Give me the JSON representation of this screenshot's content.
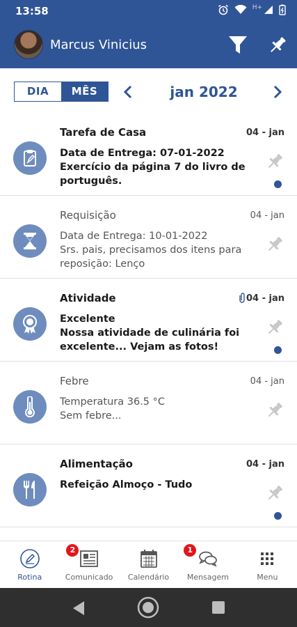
{
  "status_bar": {
    "time": "13:58",
    "network_label": "H+"
  },
  "header": {
    "user_name": "Marcus Vinicius"
  },
  "view_toggle": {
    "day_label": "DIA",
    "month_label": "MÊS",
    "selected": "MÊS"
  },
  "month_nav": {
    "current": "jan 2022"
  },
  "items": [
    {
      "title": "Tarefa de Casa",
      "date": "04 - jan",
      "line1": "Data de Entrega: 07-01-2022",
      "line2": "Exercício da página 7 do livro de português.",
      "unread": true,
      "attachment": false,
      "icon": "clipboard-icon"
    },
    {
      "title": "Requisição",
      "date": "04 - jan",
      "line1": "Data de Entrega: 10-01-2022",
      "line2": "Srs. pais, precisamos dos itens para reposição: Lenço",
      "unread": false,
      "attachment": false,
      "icon": "hourglass-icon"
    },
    {
      "title": "Atividade",
      "date": "04 - jan",
      "line1": "Excelente",
      "line2": "Nossa atividade de culinária foi excelente... Vejam as fotos!",
      "unread": true,
      "attachment": true,
      "icon": "award-icon"
    },
    {
      "title": "Febre",
      "date": "04 - jan",
      "line1": "Temperatura 36.5 °C",
      "line2": "Sem febre...",
      "unread": false,
      "attachment": false,
      "icon": "thermometer-icon"
    },
    {
      "title": "Alimentação",
      "date": "04 - jan",
      "line1": "Refeição Almoço - Tudo",
      "line2": "",
      "unread": true,
      "attachment": false,
      "icon": "fork-knife-icon"
    }
  ],
  "tabs": [
    {
      "label": "Rotina",
      "icon": "pencil-circle-icon",
      "active": true,
      "badge": ""
    },
    {
      "label": "Comunicado",
      "icon": "newspaper-icon",
      "active": false,
      "badge": "2"
    },
    {
      "label": "Calendário",
      "icon": "calendar-icon",
      "active": false,
      "badge": ""
    },
    {
      "label": "Mensagem",
      "icon": "chat-icon",
      "active": false,
      "badge": "1"
    },
    {
      "label": "Menu",
      "icon": "grid-icon",
      "active": false,
      "badge": ""
    }
  ],
  "colors": {
    "primary": "#2f5596",
    "icon_circle": "#6e8dbe",
    "badge": "#e3141b",
    "pin_gray": "#c8c8c8"
  }
}
